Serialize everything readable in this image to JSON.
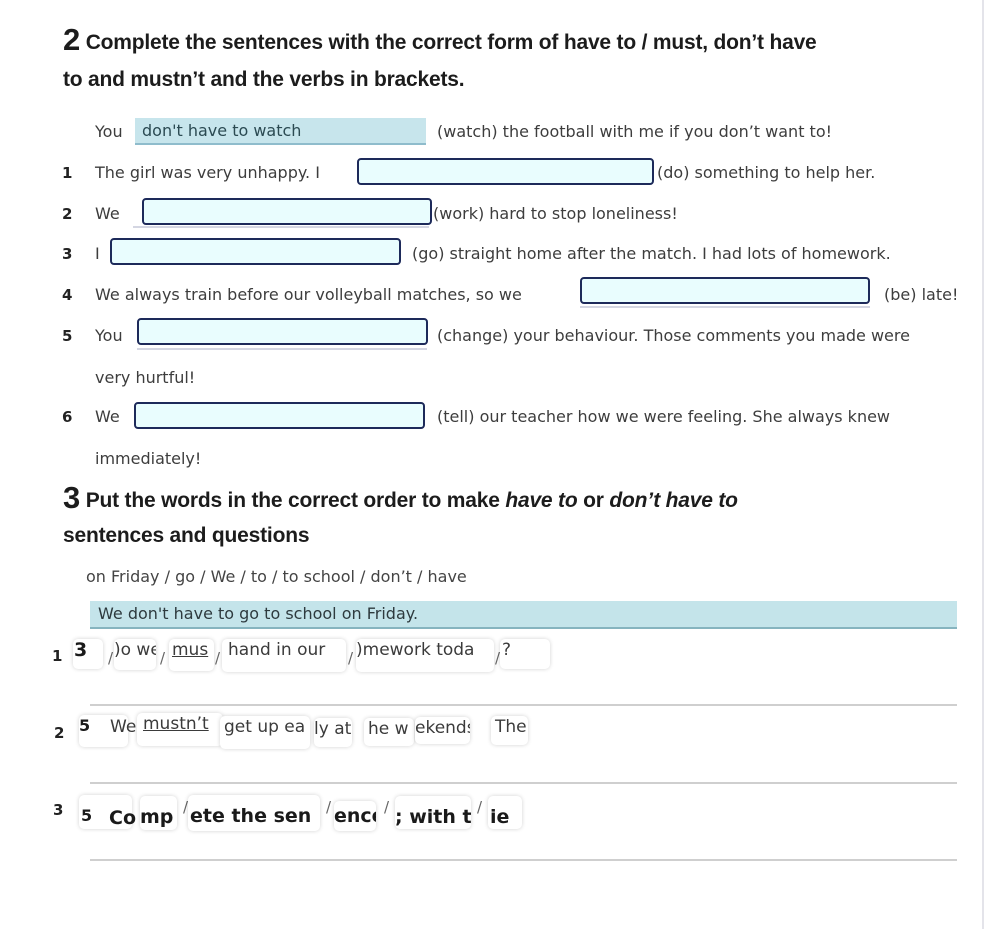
{
  "section2": {
    "number": "2",
    "title_line1": "Complete the sentences with the correct form of have to / must, don’t have",
    "title_line2": "to and mustn’t and the verbs in brackets.",
    "example": {
      "before": "You",
      "answer": "don't have to watch",
      "after": "(watch) the football with me if you don’t want to!"
    },
    "questions": [
      {
        "num": "1",
        "before": "The girl was very unhappy. I",
        "after": "(do) something to help her.",
        "value": ""
      },
      {
        "num": "2",
        "before": "We",
        "after": "(work) hard to stop loneliness!",
        "value": ""
      },
      {
        "num": "3",
        "before": "I",
        "after": "(go) straight home after the match. I had lots of homework.",
        "value": ""
      },
      {
        "num": "4",
        "before": "We always train before our volleyball matches, so we",
        "after": "(be) late!",
        "value": ""
      },
      {
        "num": "5",
        "before": "You",
        "after": "(change) your behaviour. Those comments you made were",
        "continuation": "very hurtful!",
        "value": ""
      },
      {
        "num": "6",
        "before": "We",
        "after": "(tell) our teacher how we were feeling. She always knew",
        "continuation": "immediately!",
        "value": ""
      }
    ]
  },
  "section3": {
    "number": "3",
    "title_part1": "Put the words in the correct order to make ",
    "title_italic1": "have to",
    "title_part2": "or ",
    "title_italic2": "don’t have to",
    "title_line2": "sentences and questions",
    "example_prompt": "on Friday / go / We / to / to school / don’t / have",
    "example_answer": "We don't have to go to school on Friday.",
    "separator": "/",
    "rows": [
      {
        "num": "1",
        "tiles": [
          "3",
          ")o we",
          "mus",
          "hand in our",
          ")mework toda",
          "?"
        ]
      },
      {
        "num": "2",
        "tiles": [
          "5",
          "We",
          "mustn’t",
          "get up ea",
          "ly at",
          "he w",
          "ekends",
          "The"
        ]
      },
      {
        "num": "3",
        "tiles": [
          "5",
          "Co",
          "mp",
          "ete the sen",
          "ence",
          "; with t",
          "ie"
        ]
      }
    ]
  }
}
